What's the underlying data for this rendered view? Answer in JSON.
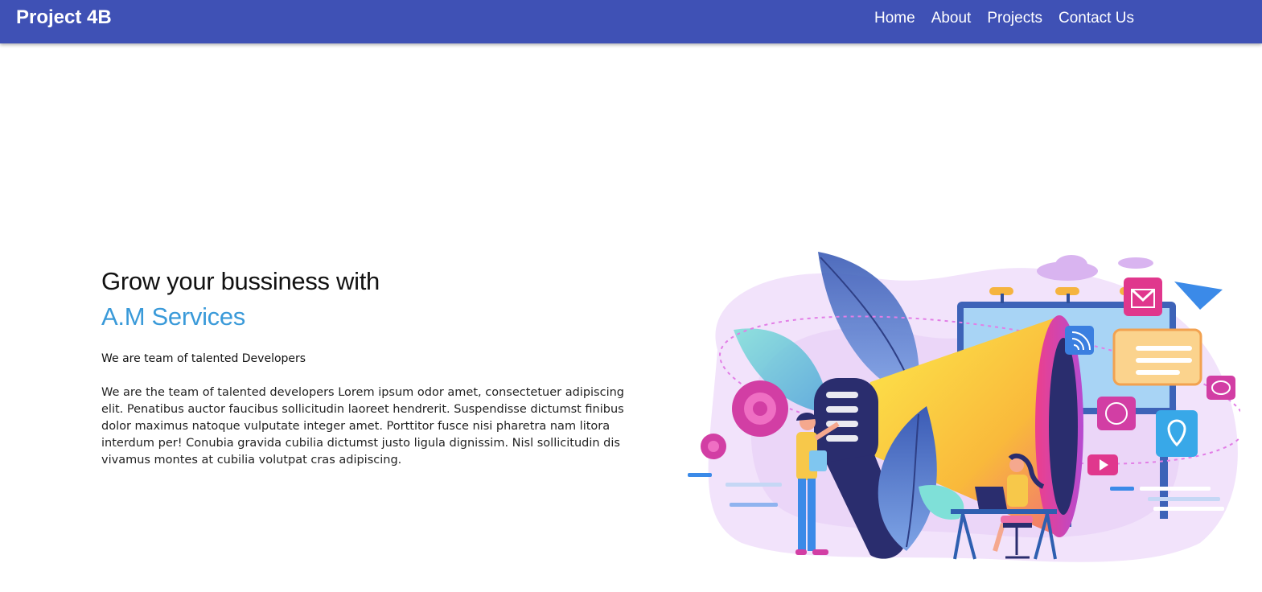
{
  "navbar": {
    "brand": "Project 4B",
    "links": [
      "Home",
      "About",
      "Projects",
      "Contact Us"
    ]
  },
  "hero": {
    "title_line1": "Grow your bussiness with",
    "title_line2": "A.M Services",
    "tagline": "We are team of talented Developers",
    "description": "We are the team of talented developers Lorem ipsum odor amet, consectetuer adipiscing elit. Penatibus auctor faucibus sollicitudin laoreet hendrerit. Suspendisse dictumst finibus dolor maximus natoque vulputate integer amet. Porttitor fusce nisi pharetra nam litora interdum per! Conubia gravida cubilia dictumst justo ligula dignissim. Nisl sollicitudin dis vivamus montes at cubilia volutpat cras adipiscing."
  },
  "colors": {
    "navbar": "#3f51b5",
    "accent": "#3a9ad9"
  }
}
